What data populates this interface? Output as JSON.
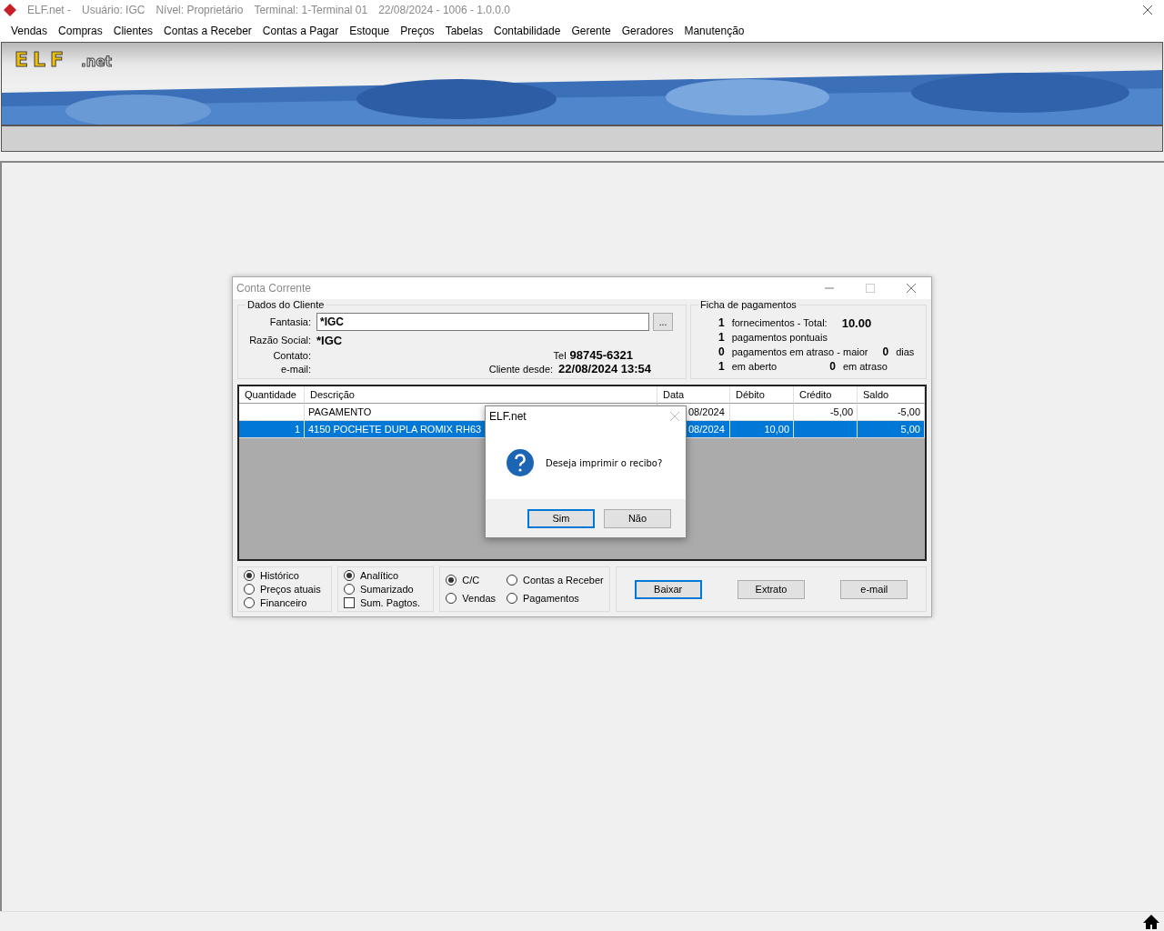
{
  "app_title": {
    "name": "ELF.net -",
    "user": "Usuário: IGC",
    "level": "Nível: Proprietário",
    "terminal": "Terminal: 1-Terminal 01",
    "info": "22/08/2024 - 1006 - 1.0.0.0"
  },
  "menu": [
    {
      "label": "Vendas"
    },
    {
      "label": "Compras"
    },
    {
      "label": "Clientes"
    },
    {
      "label": "Contas a Receber"
    },
    {
      "label": "Contas a Pagar"
    },
    {
      "label": "Estoque"
    },
    {
      "label": "Preços"
    },
    {
      "label": "Tabelas"
    },
    {
      "label": "Contabilidade"
    },
    {
      "label": "Gerente"
    },
    {
      "label": "Geradores"
    },
    {
      "label": "Manutenção"
    }
  ],
  "banner": {
    "logo": "ELF",
    "logo_suffix": ".net"
  },
  "window": {
    "title": "Conta Corrente",
    "maximize_disabled": true,
    "client": {
      "group_title": "Dados do Cliente",
      "fantasia_label": "Fantasia:",
      "fantasia_value": "*IGC",
      "lookup_button": "...",
      "razao_label": "Razão Social:",
      "razao_value": "*IGC",
      "contato_label": "Contato:",
      "email_label": "e-mail:",
      "tel_label": "Tel",
      "tel_value": "98745-6321",
      "since_label": "Cliente desde:",
      "since_value": "22/08/2024 13:54"
    },
    "payments": {
      "group_title": "Ficha de pagamentos",
      "rows": [
        {
          "count": "1",
          "label": "fornecimentos - Total:",
          "value": "10.00"
        },
        {
          "count": "1",
          "label": "pagamentos pontuais"
        },
        {
          "count": "0",
          "label": "pagamentos em atraso - maior",
          "value": "0",
          "unit": "dias"
        },
        {
          "count": "1",
          "label": "em aberto",
          "value": "0",
          "unit": "em atraso"
        }
      ]
    },
    "table": {
      "columns": [
        "Quantidade",
        "Descrição",
        "Data",
        "Débito",
        "Crédito",
        "Saldo"
      ],
      "rows": [
        {
          "selected": false,
          "cells": [
            "",
            "PAGAMENTO",
            "08/2024",
            "",
            "-5,00",
            "-5,00"
          ]
        },
        {
          "selected": true,
          "cells": [
            "1",
            "4150 POCHETE DUPLA ROMIX RH63",
            "08/2024",
            "10,00",
            "",
            "5,00"
          ]
        }
      ]
    },
    "option_groups": [
      {
        "items": [
          {
            "kind": "radio",
            "label": "Histórico",
            "selected": true
          },
          {
            "kind": "radio",
            "label": "Preços atuais",
            "selected": false
          },
          {
            "kind": "radio",
            "label": "Financeiro",
            "selected": false
          }
        ]
      },
      {
        "items": [
          {
            "kind": "radio",
            "label": "Analítico",
            "selected": true
          },
          {
            "kind": "radio",
            "label": "Sumarizado",
            "selected": false
          },
          {
            "kind": "checkbox",
            "label": "Sum. Pagtos.",
            "checked": false
          }
        ]
      },
      {
        "grid": true,
        "items": [
          {
            "kind": "radio",
            "label": "C/C",
            "selected": true
          },
          {
            "kind": "radio",
            "label": "Contas a Receber",
            "selected": false
          },
          {
            "kind": "radio",
            "label": "Vendas",
            "selected": false
          },
          {
            "kind": "radio",
            "label": "Pagamentos",
            "selected": false
          }
        ]
      }
    ],
    "buttons": [
      {
        "label": "Baixar",
        "default": true
      },
      {
        "label": "Extrato",
        "default": false
      },
      {
        "label": "e-mail",
        "default": false
      }
    ]
  },
  "dialog": {
    "title": "ELF.net",
    "message": "Deseja imprimir o recibo?",
    "buttons": [
      {
        "label": "Sim",
        "default": true
      },
      {
        "label": "Não",
        "default": false
      }
    ]
  }
}
